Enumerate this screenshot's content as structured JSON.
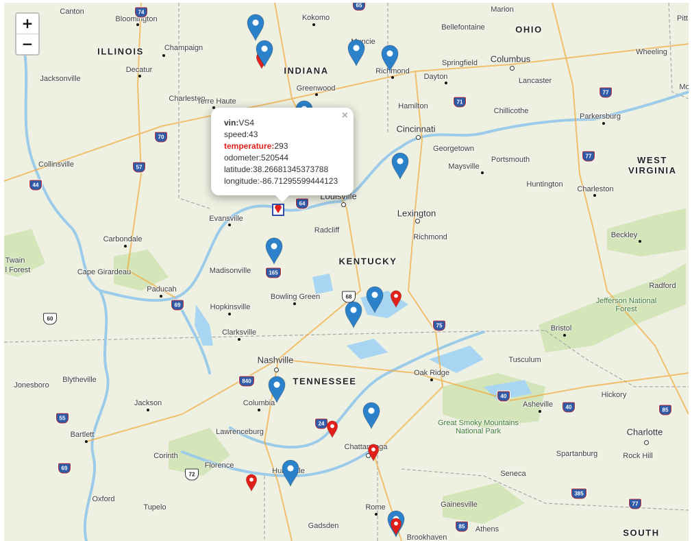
{
  "controls": {
    "zoom_in": "+",
    "zoom_out": "−"
  },
  "popup": {
    "close": "×",
    "fields": [
      {
        "key": "vin",
        "sep": ":",
        "value": "VS4",
        "bold": true
      },
      {
        "key": "speed",
        "sep": ":",
        "value": "43"
      },
      {
        "key": "temperature",
        "sep": ":",
        "value": "293",
        "bold": true,
        "alert": true
      },
      {
        "key": "odometer",
        "sep": ":",
        "value": "520544"
      },
      {
        "key": "latitude",
        "sep": ":",
        "value": "38.26681345373788"
      },
      {
        "key": "longitude",
        "sep": ":",
        "value": "-86.71295599444123"
      }
    ]
  },
  "states": [
    "ILLINOIS",
    "INDIANA",
    "OHIO",
    "KENTUCKY",
    "TENNESSEE",
    "WEST VIRGINIA",
    "SOUTH"
  ],
  "cities": [
    "Canton",
    "Bloomington",
    "Kokomo",
    "Marion",
    "Pitt",
    "Champaign",
    "Muncie",
    "Bellefontaine",
    "Wheeling",
    "Decatur",
    "Richmond",
    "Springfield",
    "Columbus",
    "Jacksonville",
    "Dayton",
    "Lancaster",
    "Mo",
    "Greenwood",
    "Charleston",
    "Terre Haute",
    "Hamilton",
    "Chillicothe",
    "Parkersburg",
    "Cincinnati",
    "Georgetown",
    "Portsmouth",
    "Collinsville",
    "Maysville",
    "Huntington",
    "Charleston",
    "Louisville",
    "Evansville",
    "Lexington",
    "Radcliff",
    "Carbondale",
    "Richmond",
    "Beckley",
    "Twain",
    "l Forest",
    "Cape Girardeau",
    "Madisonville",
    "Paducah",
    "Radford",
    "Bowling Green",
    "Hopkinsville",
    "Clarksville",
    "Bristol",
    "Nashville",
    "Tusculum",
    "Blytheville",
    "Oak Ridge",
    "Jonesboro",
    "Jackson",
    "Columbia",
    "Hickory",
    "Asheville",
    "Bartlett",
    "Lawrenceburg",
    "Charlotte",
    "Chattanooga",
    "Corinth",
    "Spartanburg",
    "Rock Hill",
    "Florence",
    "Huntsville",
    "Seneca",
    "Oxford",
    "Tupelo",
    "Rome",
    "Gainesville",
    "Gadsden",
    "Athens",
    "Brookhaven"
  ],
  "parks": [
    "Jefferson National Forest",
    "Great Smoky Mountains National Park"
  ],
  "highways": [
    "74",
    "65",
    "70",
    "71",
    "77",
    "57",
    "44",
    "64",
    "77",
    "165",
    "68",
    "69",
    "60",
    "75",
    "840",
    "40",
    "24",
    "40",
    "85",
    "55",
    "72",
    "69",
    "385",
    "77",
    "85"
  ],
  "markers": [
    {
      "id": "m1",
      "color": "blue"
    },
    {
      "id": "m2",
      "color": "red"
    },
    {
      "id": "m3",
      "color": "blue"
    },
    {
      "id": "m4",
      "color": "blue"
    },
    {
      "id": "m5",
      "color": "blue"
    },
    {
      "id": "m6",
      "color": "blue"
    },
    {
      "id": "m7",
      "color": "blue"
    },
    {
      "id": "m8",
      "color": "blue"
    },
    {
      "id": "m9",
      "color": "blue"
    },
    {
      "id": "m10",
      "color": "blue"
    },
    {
      "id": "m11",
      "color": "red"
    },
    {
      "id": "m12",
      "color": "blue"
    },
    {
      "id": "m13",
      "color": "red"
    },
    {
      "id": "m14",
      "color": "blue"
    },
    {
      "id": "m15",
      "color": "red"
    },
    {
      "id": "m16",
      "color": "blue"
    },
    {
      "id": "m17",
      "color": "red"
    },
    {
      "id": "m18",
      "color": "blue"
    },
    {
      "id": "m19",
      "color": "red"
    }
  ],
  "colors": {
    "marker_blue": "#2b82cb",
    "marker_red": "#e0201a",
    "water": "#a8d5f2",
    "land": "#eef0e2",
    "forest": "#cfe3b5"
  }
}
